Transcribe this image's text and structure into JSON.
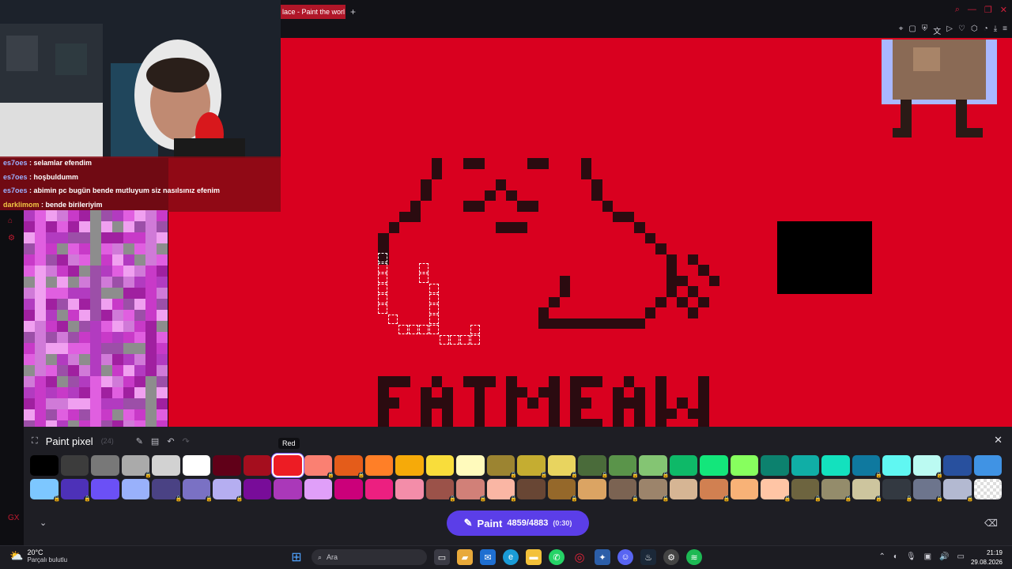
{
  "browser": {
    "tab_title": "lace - Paint the worl",
    "tab_add": "+"
  },
  "chat": [
    {
      "user": "es7oes",
      "message": ": selamlar efendim"
    },
    {
      "user": "es7oes",
      "message": ": hoşbuldumm"
    },
    {
      "user": "es7oes",
      "message": ": abimin pc bugün bende mutluyum siz nasılsınız efenim"
    },
    {
      "user": "darklimom",
      "message": ": bende birileriyim"
    }
  ],
  "canvas": {
    "background_color": "#d9001f",
    "art_color": "#2b0b10"
  },
  "paint_panel": {
    "title": "Paint pixel",
    "count_hint": "(24)",
    "tooltip": "Red",
    "paint_label": "Paint",
    "paint_count": "4859/4883",
    "paint_timer": "(0:30)",
    "selected_color": "#e0162b"
  },
  "palette": {
    "row1": [
      {
        "color": "#000000",
        "locked": false
      },
      {
        "color": "#3c3c3c",
        "locked": false
      },
      {
        "color": "#787878",
        "locked": false
      },
      {
        "color": "#aaaaaa",
        "locked": true
      },
      {
        "color": "#d2d2d2",
        "locked": false
      },
      {
        "color": "#ffffff",
        "locked": false
      },
      {
        "color": "#600018",
        "locked": false
      },
      {
        "color": "#a50e1e",
        "locked": false
      },
      {
        "color": "#ed1c24",
        "locked": false
      },
      {
        "color": "#fa8072",
        "locked": true
      },
      {
        "color": "#e45c1a",
        "locked": true
      },
      {
        "color": "#ff7f27",
        "locked": false
      },
      {
        "color": "#f6aa09",
        "locked": false
      },
      {
        "color": "#f9dd3b",
        "locked": false
      },
      {
        "color": "#fffabc",
        "locked": false
      },
      {
        "color": "#9c8431",
        "locked": true
      },
      {
        "color": "#c5ad31",
        "locked": true
      },
      {
        "color": "#e8d45f",
        "locked": true
      },
      {
        "color": "#4a6b3a",
        "locked": true
      },
      {
        "color": "#5a944a",
        "locked": true
      },
      {
        "color": "#84c573",
        "locked": true
      },
      {
        "color": "#0eb968",
        "locked": false
      },
      {
        "color": "#13e67b",
        "locked": false
      },
      {
        "color": "#87ff5e",
        "locked": false
      },
      {
        "color": "#0c816e",
        "locked": false
      },
      {
        "color": "#10aea6",
        "locked": false
      },
      {
        "color": "#13e1be",
        "locked": false
      },
      {
        "color": "#0f799f",
        "locked": true
      },
      {
        "color": "#60f7f2",
        "locked": false
      },
      {
        "color": "#bbfaf2",
        "locked": true
      },
      {
        "color": "#28509e",
        "locked": false
      },
      {
        "color": "#4093e4",
        "locked": false
      }
    ],
    "row2": [
      {
        "color": "#7dc7ff",
        "locked": true
      },
      {
        "color": "#4d31b8",
        "locked": true
      },
      {
        "color": "#6b50f6",
        "locked": false
      },
      {
        "color": "#99b1fb",
        "locked": false
      },
      {
        "color": "#4a4284",
        "locked": true
      },
      {
        "color": "#7a71c4",
        "locked": true
      },
      {
        "color": "#b5aef1",
        "locked": true
      },
      {
        "color": "#780c99",
        "locked": false
      },
      {
        "color": "#aa38b9",
        "locked": false
      },
      {
        "color": "#e09ff9",
        "locked": false
      },
      {
        "color": "#cb007a",
        "locked": false
      },
      {
        "color": "#ec1f80",
        "locked": false
      },
      {
        "color": "#f38da9",
        "locked": false
      },
      {
        "color": "#9b5249",
        "locked": true
      },
      {
        "color": "#d18078",
        "locked": true
      },
      {
        "color": "#fab6a4",
        "locked": true
      },
      {
        "color": "#684634",
        "locked": false
      },
      {
        "color": "#95682a",
        "locked": true
      },
      {
        "color": "#dba463",
        "locked": false
      },
      {
        "color": "#7b6352",
        "locked": true
      },
      {
        "color": "#9c846b",
        "locked": true
      },
      {
        "color": "#d6b594",
        "locked": false
      },
      {
        "color": "#d18051",
        "locked": true
      },
      {
        "color": "#f8b277",
        "locked": false
      },
      {
        "color": "#ffc5a5",
        "locked": true
      },
      {
        "color": "#6d643f",
        "locked": true
      },
      {
        "color": "#948c6b",
        "locked": true
      },
      {
        "color": "#cdc59e",
        "locked": true
      },
      {
        "color": "#333941",
        "locked": true
      },
      {
        "color": "#6d758d",
        "locked": true
      },
      {
        "color": "#b3b9d1",
        "locked": true
      },
      {
        "color": "transparent",
        "locked": false
      }
    ]
  },
  "taskbar": {
    "temperature": "20°C",
    "weather_desc": "Parçalı bulutlu",
    "search_placeholder": "Ara",
    "time": "21:19",
    "date": "29.08.2026"
  }
}
